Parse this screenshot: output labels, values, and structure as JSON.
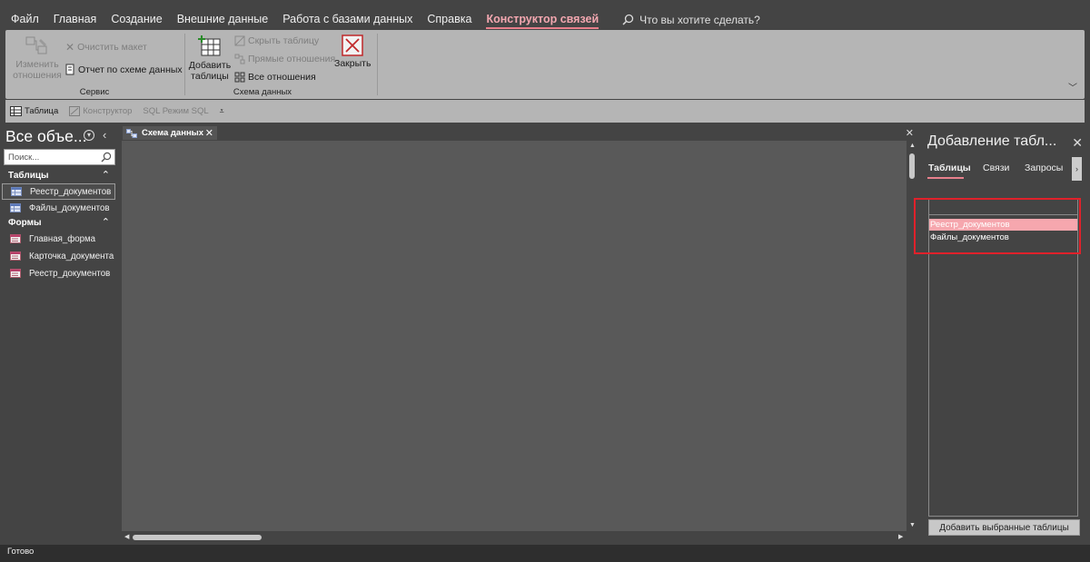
{
  "menu": {
    "items": [
      "Файл",
      "Главная",
      "Создание",
      "Внешние данные",
      "Работа с базами данных",
      "Справка"
    ],
    "active": "Конструктор связей",
    "tellme": "Что вы хотите сделать?"
  },
  "ribbon": {
    "edit_relations": "Изменить отношения",
    "clear_layout": "Очистить макет",
    "relationship_report": "Отчет по схеме данных",
    "group_service": "Сервис",
    "add_tables": "Добавить таблицы",
    "hide_table": "Скрыть таблицу",
    "direct_relationships": "Прямые отношения",
    "all_relationships": "Все отношения",
    "group_schema": "Схема данных",
    "close": "Закрыть"
  },
  "qat": {
    "table": "Таблица",
    "designer": "Конструктор",
    "sql": "SQL Режим SQL"
  },
  "nav": {
    "title": "Все объе...",
    "search_placeholder": "Поиск...",
    "section_tables": "Таблицы",
    "tables": [
      "Реестр_документов",
      "Файлы_документов"
    ],
    "section_forms": "Формы",
    "forms": [
      "Главная_форма",
      "Карточка_документа",
      "Реестр_документов"
    ]
  },
  "document": {
    "tab_label": "Схема данных"
  },
  "side_pane": {
    "title": "Добавление табл...",
    "tabs": [
      "Таблицы",
      "Связи",
      "Запросы"
    ],
    "list": [
      "Реестр_документов",
      "Файлы_документов"
    ],
    "selected_index": 0,
    "add_button": "Добавить выбранные таблицы"
  },
  "status": {
    "text": "Готово"
  },
  "colors": {
    "accent": "#f3a7b0",
    "selection": "#f6a7ae",
    "highlight_box": "#e0212a"
  }
}
